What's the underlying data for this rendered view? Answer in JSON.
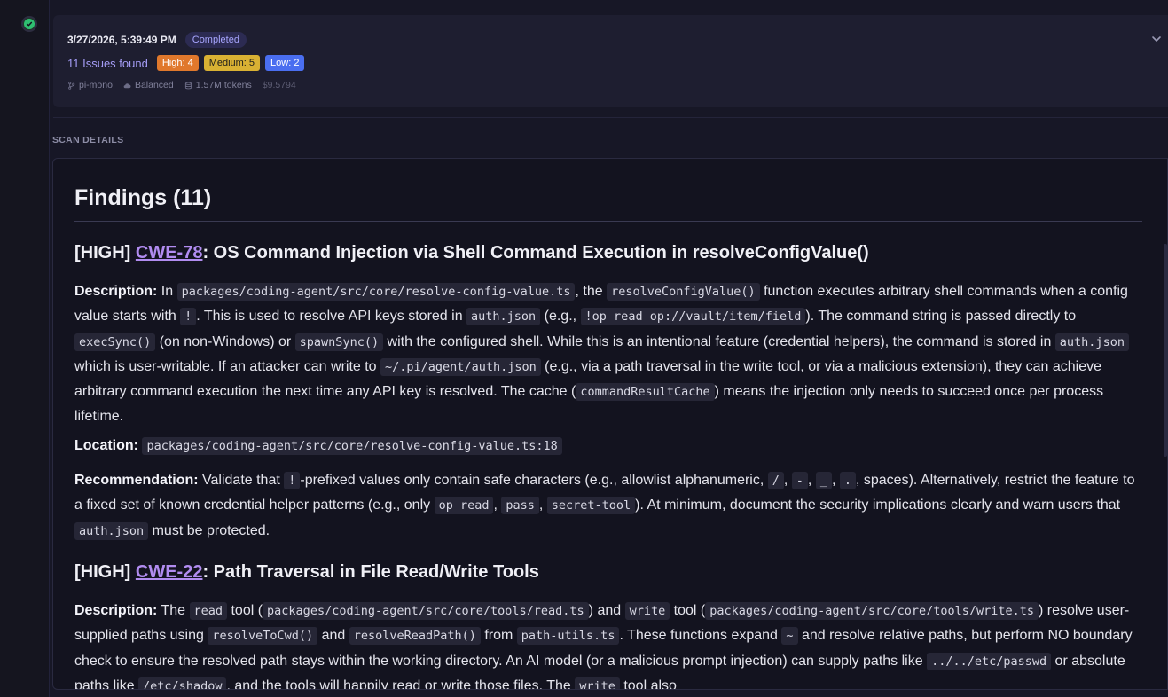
{
  "scan": {
    "date": "3/27/2026, 5:39:49 PM",
    "status": "Completed",
    "issues_found": "11 Issues found",
    "severity": {
      "high": "High: 4",
      "medium": "Medium: 5",
      "low": "Low: 2"
    },
    "repo": "pi-mono",
    "mode": "Balanced",
    "tokens": "1.57M tokens",
    "cost": "$9.5794"
  },
  "section_label": "SCAN DETAILS",
  "findings_title": "Findings (11)",
  "finding1": {
    "severity": "[HIGH]",
    "cwe": "CWE-78",
    "title": ": OS Command Injection via Shell Command Execution in resolveConfigValue()",
    "desc_label": "Description:",
    "desc": {
      "t1": " In ",
      "c1": "packages/coding-agent/src/core/resolve-config-value.ts",
      "t2": ", the ",
      "c2": "resolveConfigValue()",
      "t3": " function executes arbitrary shell commands when a config value starts with ",
      "c3": "!",
      "t4": ". This is used to resolve API keys stored in ",
      "c4": "auth.json",
      "t5": " (e.g., ",
      "c5": "!op read op://vault/item/field",
      "t6": "). The command string is passed directly to ",
      "c6": "execSync()",
      "t7": " (on non-Windows) or ",
      "c7": "spawnSync()",
      "t8": " with the configured shell. While this is an intentional feature (credential helpers), the command is stored in ",
      "c8": "auth.json",
      "t9": " which is user-writable. If an attacker can write to ",
      "c9": "~/.pi/agent/auth.json",
      "t10": " (e.g., via a path traversal in the write tool, or via a malicious extension), they can achieve arbitrary command execution the next time any API key is resolved. The cache (",
      "c10": "commandResultCache",
      "t11": ") means the injection only needs to succeed once per process lifetime."
    },
    "loc_label": "Location:",
    "location": "packages/coding-agent/src/core/resolve-config-value.ts:18",
    "rec_label": "Recommendation:",
    "rec": {
      "t1": " Validate that ",
      "c1": "!",
      "t2": "-prefixed values only contain safe characters (e.g., allowlist alphanumeric, ",
      "c2": "/",
      "t3": ", ",
      "c3": "-",
      "t4": ", ",
      "c4": "_",
      "t5": ", ",
      "c5": ".",
      "t6": ", spaces). Alternatively, restrict the feature to a fixed set of known credential helper patterns (e.g., only ",
      "c6": "op read",
      "t7": ", ",
      "c7": "pass",
      "t8": ", ",
      "c8": "secret-tool",
      "t9": "). At minimum, document the security implications clearly and warn users that ",
      "c9": "auth.json",
      "t10": " must be protected."
    }
  },
  "finding2": {
    "severity": "[HIGH]",
    "cwe": "CWE-22",
    "title": ": Path Traversal in File Read/Write Tools",
    "desc_label": "Description:",
    "desc": {
      "t1": " The ",
      "c1": "read",
      "t2": " tool (",
      "c2": "packages/coding-agent/src/core/tools/read.ts",
      "t3": ") and ",
      "c3": "write",
      "t4": " tool (",
      "c4": "packages/coding-agent/src/core/tools/write.ts",
      "t5": ") resolve user-supplied paths using ",
      "c5": "resolveToCwd()",
      "t6": " and ",
      "c6": "resolveReadPath()",
      "t7": " from ",
      "c7": "path-utils.ts",
      "t8": ". These functions expand ",
      "c8": "~",
      "t9": " and resolve relative paths, but perform NO boundary check to ensure the resolved path stays within the working directory. An AI model (or a malicious prompt injection) can supply paths like ",
      "c9": "../../etc/passwd",
      "t10": " or absolute paths like ",
      "c10": "/etc/shadow",
      "t11": ", and the tools will happily read or write those files. The ",
      "c11": "write",
      "t12": " tool also"
    }
  }
}
